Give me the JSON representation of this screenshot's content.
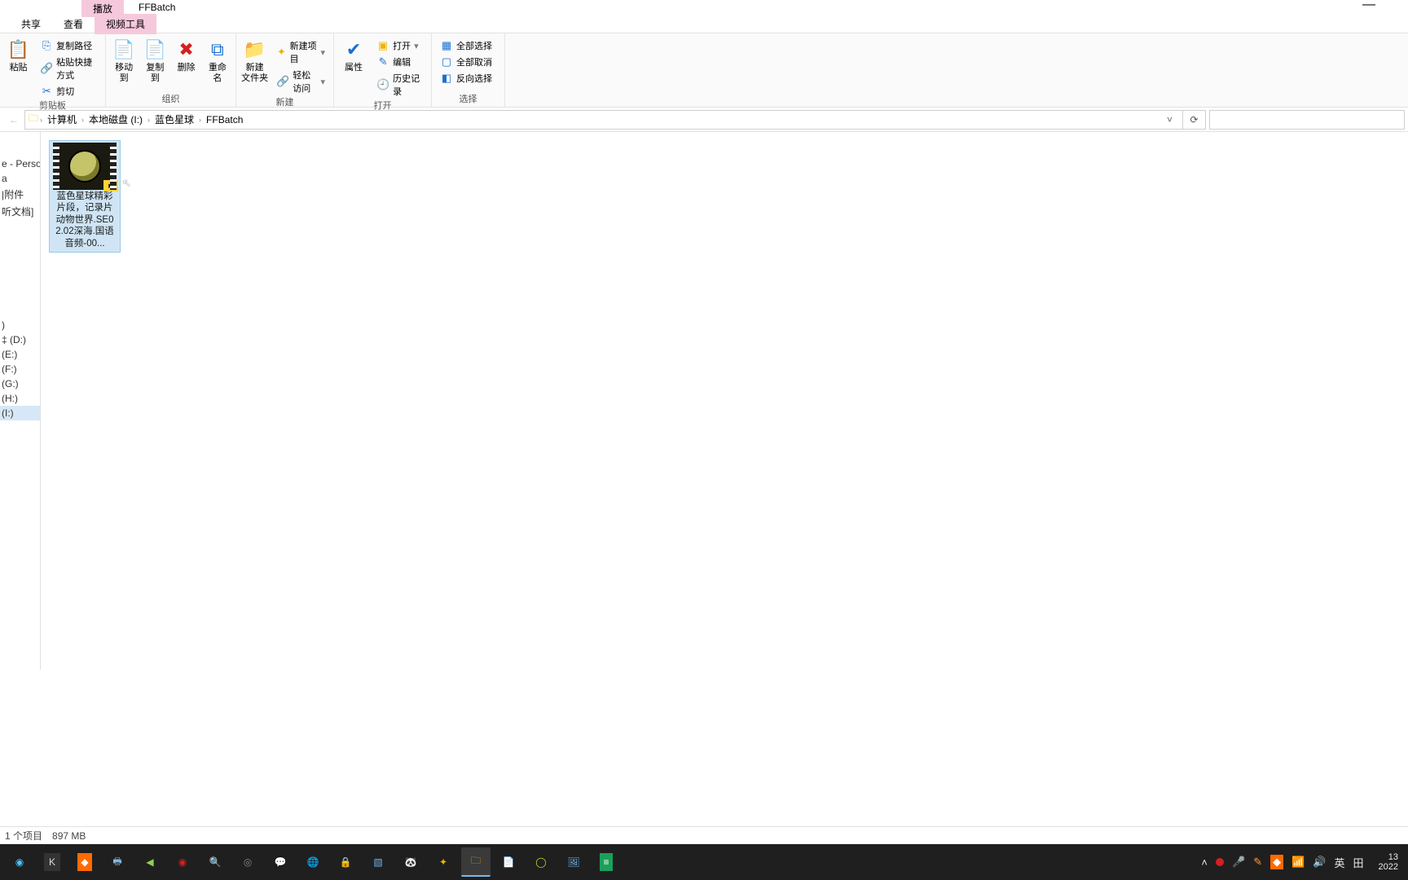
{
  "window": {
    "contextual_tab": "播放",
    "title": "FFBatch",
    "minimize_glyph": "—"
  },
  "tabs": {
    "share": "共享",
    "view": "查看",
    "video_tools": "视频工具"
  },
  "ribbon": {
    "clipboard": {
      "paste": "粘贴",
      "copy_path": "复制路径",
      "paste_shortcut": "粘贴快捷方式",
      "cut": "剪切",
      "group": "剪贴板"
    },
    "organize": {
      "move_to": "移动到",
      "copy_to": "复制到",
      "delete": "删除",
      "rename": "重命名",
      "group": "组织"
    },
    "new": {
      "new_folder_line1": "新建",
      "new_folder_line2": "文件夹",
      "new_item": "新建项目",
      "easy_access": "轻松访问",
      "group": "新建"
    },
    "open": {
      "properties": "属性",
      "open": "打开",
      "edit": "编辑",
      "history": "历史记录",
      "group": "打开"
    },
    "select": {
      "select_all": "全部选择",
      "select_none": "全部取消",
      "invert": "反向选择",
      "group": "选择"
    }
  },
  "address": {
    "segments": [
      "计算机",
      "本地磁盘 (I:)",
      "蓝色星球",
      "FFBatch"
    ]
  },
  "navpane": {
    "items": [
      "e - Persona",
      "a",
      "|附件",
      "听文档]",
      ")",
      "‡ (D:)",
      " (E:)",
      " (F:)",
      " (G:)",
      " (H:)",
      " (I:)"
    ],
    "selected_index": 10
  },
  "file": {
    "name": "蓝色星球精彩片段，记录片动物世界.SE02.02深海.国语音频-00..."
  },
  "statusbar": {
    "left": "1 个项目",
    "right": "897 MB"
  },
  "tray": {
    "ime_lang": "英",
    "ime_mode": "田",
    "clock_top": "13",
    "clock_bottom": "2022"
  },
  "icons": {
    "paste": "📋",
    "scissors": "✂",
    "link": "🔗",
    "moveto": "📄",
    "copyto": "📄",
    "delete": "✖",
    "rename": "⧉",
    "newfolder": "📁",
    "star": "✦",
    "chain": "🔗",
    "check": "✔",
    "openarrow": "▸",
    "pencil": "✎",
    "history": "🕘",
    "grid": "▦",
    "refresh": "⟳",
    "chevdown": "˅",
    "seg_sep": "›"
  }
}
